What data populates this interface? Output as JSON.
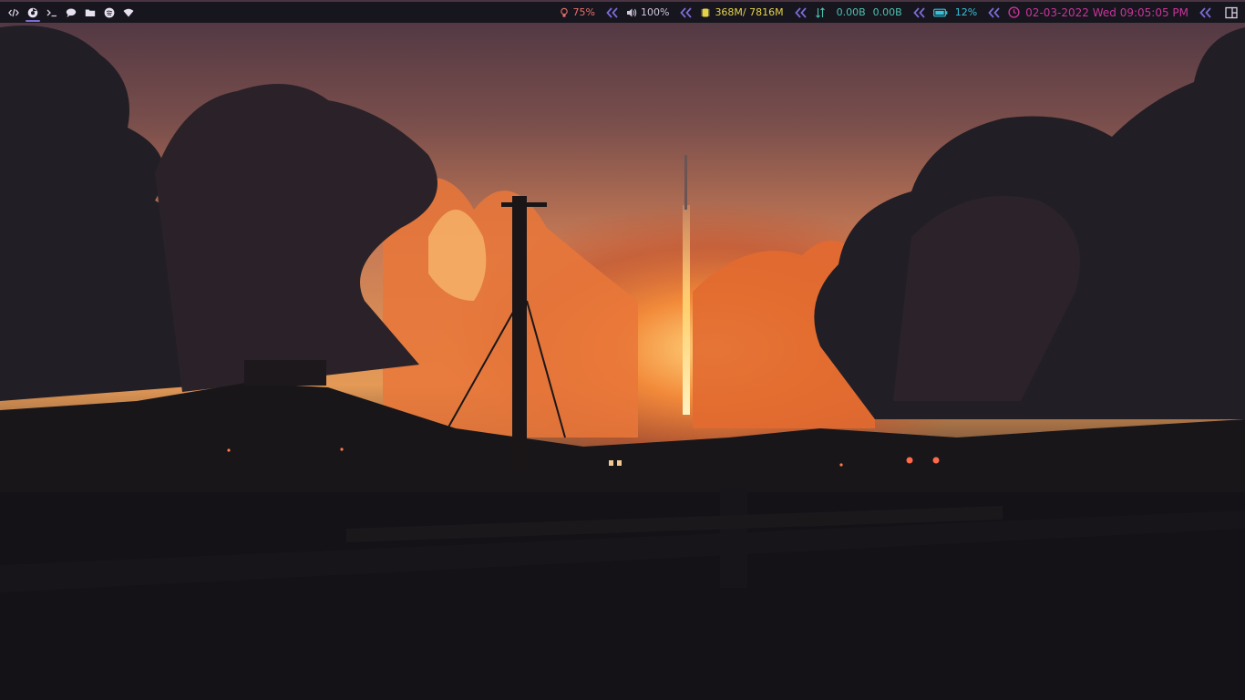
{
  "workspaces": [
    {
      "icon": "code-icon",
      "active": false
    },
    {
      "icon": "browser-icon",
      "active": true
    },
    {
      "icon": "terminal-icon",
      "active": false
    },
    {
      "icon": "chat-icon",
      "active": false
    },
    {
      "icon": "folder-icon",
      "active": false
    },
    {
      "icon": "music-icon",
      "active": false
    },
    {
      "icon": "wifi-icon",
      "active": false
    }
  ],
  "status": {
    "brightness": {
      "icon": "bulb-icon",
      "value": "75%",
      "color": "#e8706a"
    },
    "volume": {
      "icon": "speaker-icon",
      "value": "100%",
      "color": "#cfc6d8"
    },
    "memory": {
      "icon": "chip-icon",
      "value": "368M/ 7816M",
      "color": "#e6d34a"
    },
    "network": {
      "icon": "updown-icon",
      "down": "0.00B",
      "up": "0.00B",
      "color": "#4fc1b0"
    },
    "battery": {
      "icon": "battery-icon",
      "value": "12%",
      "color": "#35c1d8"
    },
    "clock": {
      "icon": "clock-icon",
      "value": "02-03-2022 Wed 09:05:05 PM",
      "color": "#c8349a"
    }
  },
  "separator_color": "#7b6bd6",
  "layout_icon": "layout-icon"
}
